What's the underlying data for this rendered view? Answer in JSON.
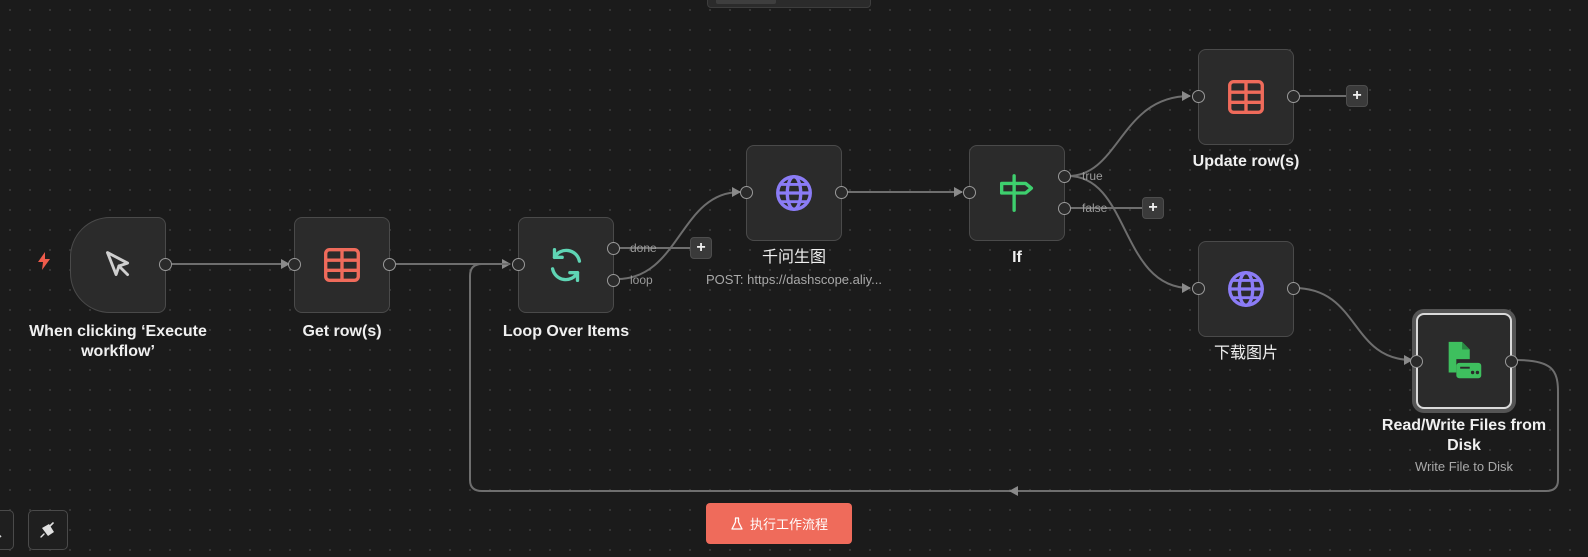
{
  "canvas": {
    "nodes": {
      "trigger": {
        "label": "When clicking ‘Execute workflow’",
        "icon": "mouse-pointer-icon"
      },
      "get_rows": {
        "label": "Get row(s)",
        "icon": "table-icon"
      },
      "loop": {
        "label": "Loop Over Items",
        "icon": "refresh-icon",
        "outputs": [
          "done",
          "loop"
        ]
      },
      "http1": {
        "label": "千问生图",
        "subtitle": "POST: https://dashscope.aliy...",
        "icon": "globe-icon"
      },
      "if": {
        "label": "If",
        "icon": "signpost-icon",
        "outputs": [
          "true",
          "false"
        ]
      },
      "update_rows": {
        "label": "Update row(s)",
        "icon": "table-icon"
      },
      "download": {
        "label": "下载图片",
        "icon": "globe-icon"
      },
      "files": {
        "label": "Read/Write Files from Disk",
        "subtitle": "Write File to Disk",
        "icon": "file-disk-icon"
      }
    },
    "plus_symbol": "+"
  },
  "toolbar": {
    "execute_label": "执行工作流程"
  },
  "colors": {
    "table_icon": "#ef6b5b",
    "refresh_icon": "#5fd4b4",
    "globe_icon": "#8b7cf6",
    "signpost_icon": "#3ecf6e",
    "file_icon": "#3ebf5e",
    "execute_button": "#ef6b5b",
    "bolt": "#ef5b4b"
  }
}
